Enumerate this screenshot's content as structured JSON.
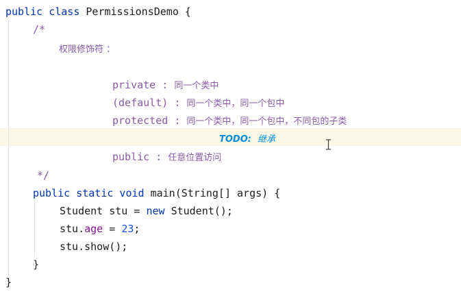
{
  "editor": {
    "line1": {
      "kw": "public class",
      "name": "PermissionsDemo",
      "brace": "{"
    },
    "comment_open": "/*",
    "heading": "权限修饰符 ：",
    "private": {
      "kw": "private",
      "sep": ":",
      "desc": "同一个类中"
    },
    "default": {
      "kw": "(default)",
      "sep": ":",
      "desc": "同一个类中，同一个包中"
    },
    "protected": {
      "kw": "protected",
      "sep": ":",
      "desc": "同一个类中，同一个包中，不同包的子类"
    },
    "todo": {
      "tag": "TODO:",
      "text": "继承"
    },
    "public": {
      "kw": "public",
      "sep": ":",
      "desc": "任意位置访问"
    },
    "comment_close": "*/",
    "main_sig": {
      "kw": "public static void",
      "name": "main(String[] args)",
      "brace": "{"
    },
    "stmt1": {
      "type": "Student stu =",
      "kw": "new",
      "rest": "Student();"
    },
    "stmt2": {
      "obj": "stu.",
      "field": "age",
      "eq": " = ",
      "num": "23",
      "semi": ";"
    },
    "stmt3": "stu.show();",
    "close_method": "}",
    "close_class": "}"
  }
}
